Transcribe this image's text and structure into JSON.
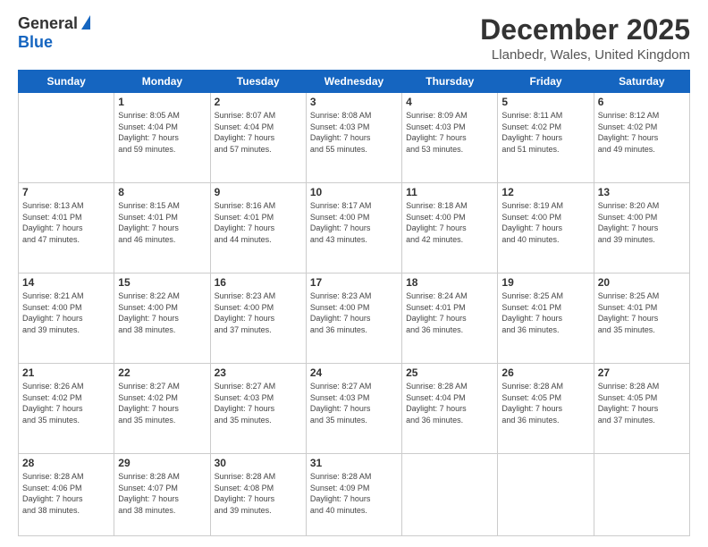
{
  "logo": {
    "general": "General",
    "blue": "Blue"
  },
  "header": {
    "month": "December 2025",
    "location": "Llanbedr, Wales, United Kingdom"
  },
  "days_of_week": [
    "Sunday",
    "Monday",
    "Tuesday",
    "Wednesday",
    "Thursday",
    "Friday",
    "Saturday"
  ],
  "weeks": [
    [
      {
        "day": "",
        "info": ""
      },
      {
        "day": "1",
        "info": "Sunrise: 8:05 AM\nSunset: 4:04 PM\nDaylight: 7 hours\nand 59 minutes."
      },
      {
        "day": "2",
        "info": "Sunrise: 8:07 AM\nSunset: 4:04 PM\nDaylight: 7 hours\nand 57 minutes."
      },
      {
        "day": "3",
        "info": "Sunrise: 8:08 AM\nSunset: 4:03 PM\nDaylight: 7 hours\nand 55 minutes."
      },
      {
        "day": "4",
        "info": "Sunrise: 8:09 AM\nSunset: 4:03 PM\nDaylight: 7 hours\nand 53 minutes."
      },
      {
        "day": "5",
        "info": "Sunrise: 8:11 AM\nSunset: 4:02 PM\nDaylight: 7 hours\nand 51 minutes."
      },
      {
        "day": "6",
        "info": "Sunrise: 8:12 AM\nSunset: 4:02 PM\nDaylight: 7 hours\nand 49 minutes."
      }
    ],
    [
      {
        "day": "7",
        "info": "Sunrise: 8:13 AM\nSunset: 4:01 PM\nDaylight: 7 hours\nand 47 minutes."
      },
      {
        "day": "8",
        "info": "Sunrise: 8:15 AM\nSunset: 4:01 PM\nDaylight: 7 hours\nand 46 minutes."
      },
      {
        "day": "9",
        "info": "Sunrise: 8:16 AM\nSunset: 4:01 PM\nDaylight: 7 hours\nand 44 minutes."
      },
      {
        "day": "10",
        "info": "Sunrise: 8:17 AM\nSunset: 4:00 PM\nDaylight: 7 hours\nand 43 minutes."
      },
      {
        "day": "11",
        "info": "Sunrise: 8:18 AM\nSunset: 4:00 PM\nDaylight: 7 hours\nand 42 minutes."
      },
      {
        "day": "12",
        "info": "Sunrise: 8:19 AM\nSunset: 4:00 PM\nDaylight: 7 hours\nand 40 minutes."
      },
      {
        "day": "13",
        "info": "Sunrise: 8:20 AM\nSunset: 4:00 PM\nDaylight: 7 hours\nand 39 minutes."
      }
    ],
    [
      {
        "day": "14",
        "info": "Sunrise: 8:21 AM\nSunset: 4:00 PM\nDaylight: 7 hours\nand 39 minutes."
      },
      {
        "day": "15",
        "info": "Sunrise: 8:22 AM\nSunset: 4:00 PM\nDaylight: 7 hours\nand 38 minutes."
      },
      {
        "day": "16",
        "info": "Sunrise: 8:23 AM\nSunset: 4:00 PM\nDaylight: 7 hours\nand 37 minutes."
      },
      {
        "day": "17",
        "info": "Sunrise: 8:23 AM\nSunset: 4:00 PM\nDaylight: 7 hours\nand 36 minutes."
      },
      {
        "day": "18",
        "info": "Sunrise: 8:24 AM\nSunset: 4:01 PM\nDaylight: 7 hours\nand 36 minutes."
      },
      {
        "day": "19",
        "info": "Sunrise: 8:25 AM\nSunset: 4:01 PM\nDaylight: 7 hours\nand 36 minutes."
      },
      {
        "day": "20",
        "info": "Sunrise: 8:25 AM\nSunset: 4:01 PM\nDaylight: 7 hours\nand 35 minutes."
      }
    ],
    [
      {
        "day": "21",
        "info": "Sunrise: 8:26 AM\nSunset: 4:02 PM\nDaylight: 7 hours\nand 35 minutes."
      },
      {
        "day": "22",
        "info": "Sunrise: 8:27 AM\nSunset: 4:02 PM\nDaylight: 7 hours\nand 35 minutes."
      },
      {
        "day": "23",
        "info": "Sunrise: 8:27 AM\nSunset: 4:03 PM\nDaylight: 7 hours\nand 35 minutes."
      },
      {
        "day": "24",
        "info": "Sunrise: 8:27 AM\nSunset: 4:03 PM\nDaylight: 7 hours\nand 35 minutes."
      },
      {
        "day": "25",
        "info": "Sunrise: 8:28 AM\nSunset: 4:04 PM\nDaylight: 7 hours\nand 36 minutes."
      },
      {
        "day": "26",
        "info": "Sunrise: 8:28 AM\nSunset: 4:05 PM\nDaylight: 7 hours\nand 36 minutes."
      },
      {
        "day": "27",
        "info": "Sunrise: 8:28 AM\nSunset: 4:05 PM\nDaylight: 7 hours\nand 37 minutes."
      }
    ],
    [
      {
        "day": "28",
        "info": "Sunrise: 8:28 AM\nSunset: 4:06 PM\nDaylight: 7 hours\nand 38 minutes."
      },
      {
        "day": "29",
        "info": "Sunrise: 8:28 AM\nSunset: 4:07 PM\nDaylight: 7 hours\nand 38 minutes."
      },
      {
        "day": "30",
        "info": "Sunrise: 8:28 AM\nSunset: 4:08 PM\nDaylight: 7 hours\nand 39 minutes."
      },
      {
        "day": "31",
        "info": "Sunrise: 8:28 AM\nSunset: 4:09 PM\nDaylight: 7 hours\nand 40 minutes."
      },
      {
        "day": "",
        "info": ""
      },
      {
        "day": "",
        "info": ""
      },
      {
        "day": "",
        "info": ""
      }
    ]
  ]
}
